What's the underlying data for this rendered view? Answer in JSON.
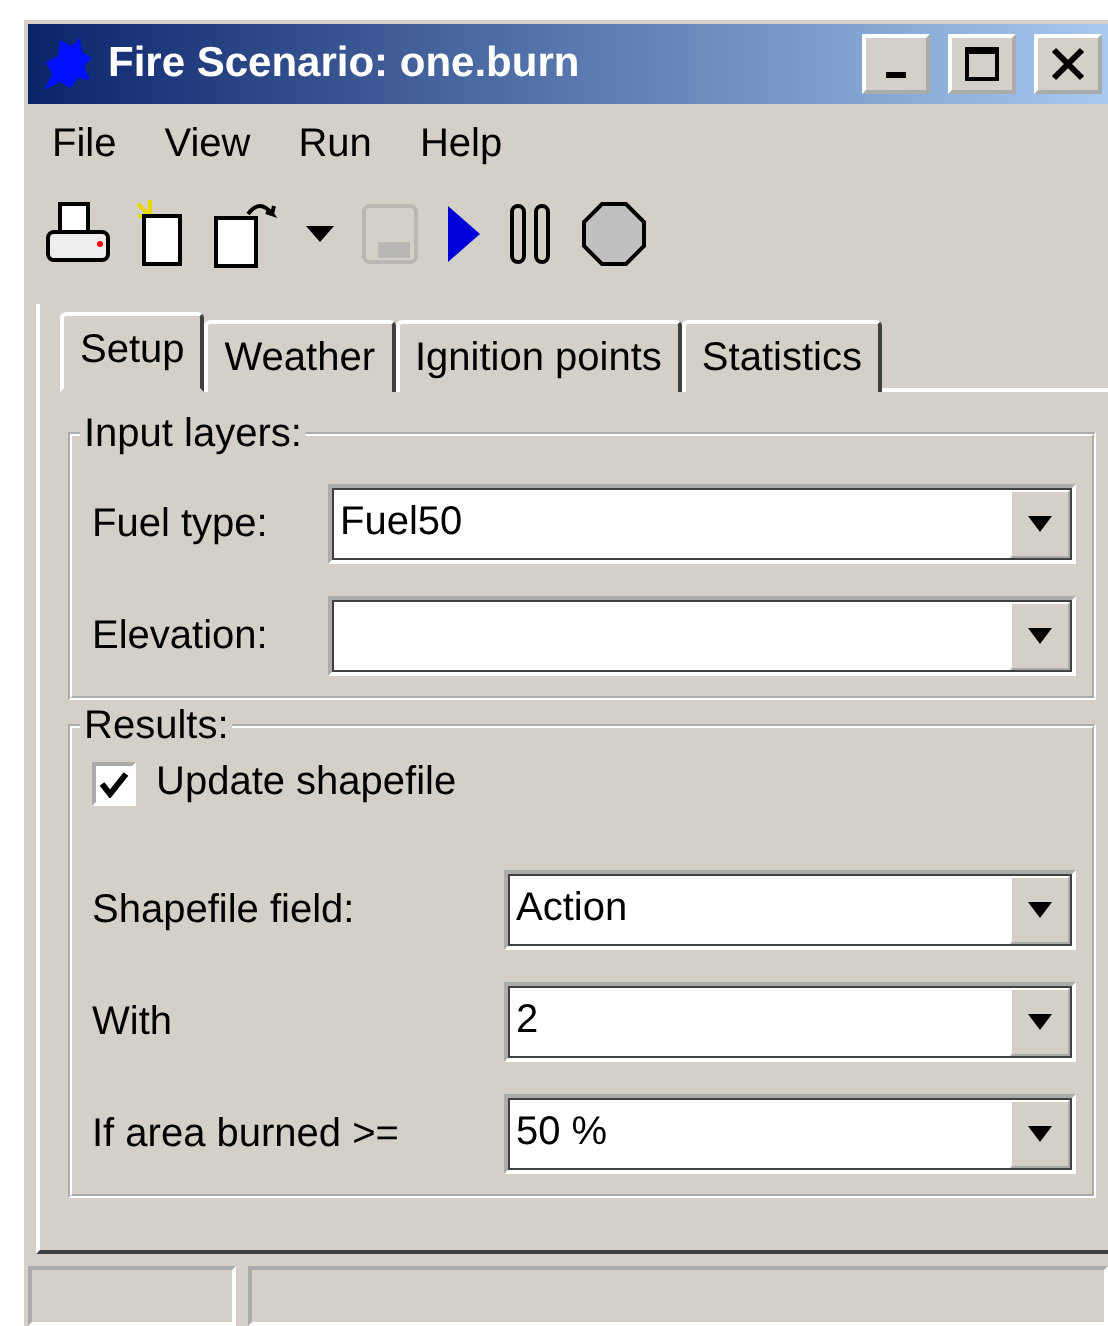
{
  "window": {
    "title": "Fire Scenario: one.burn"
  },
  "menu": [
    "File",
    "View",
    "Run",
    "Help"
  ],
  "toolbar": [
    {
      "kind": "print",
      "disabled": false
    },
    {
      "kind": "new",
      "disabled": false
    },
    {
      "kind": "open",
      "disabled": false
    },
    {
      "kind": "dropdown",
      "disabled": false
    },
    {
      "kind": "save",
      "disabled": true
    },
    {
      "kind": "play",
      "disabled": false
    },
    {
      "kind": "pause",
      "disabled": false
    },
    {
      "kind": "stop",
      "disabled": false
    }
  ],
  "tabs": [
    {
      "label": "Setup",
      "selected": true
    },
    {
      "label": "Weather",
      "selected": false
    },
    {
      "label": "Ignition points",
      "selected": false
    },
    {
      "label": "Statistics",
      "selected": false
    }
  ],
  "input_layers": {
    "title": "Input layers:",
    "fields": [
      {
        "label": "Fuel type:",
        "value": "Fuel50"
      },
      {
        "label": "Elevation:"
      }
    ]
  },
  "results": {
    "title": "Results:",
    "update_shapefile": {
      "label": "Update shapefile",
      "checked": true
    },
    "fields": [
      {
        "label": "Shapefile field:",
        "value": "Action"
      },
      {
        "label": "With",
        "value": "2"
      },
      {
        "label": "If area burned >=",
        "value": "50 %"
      }
    ]
  }
}
